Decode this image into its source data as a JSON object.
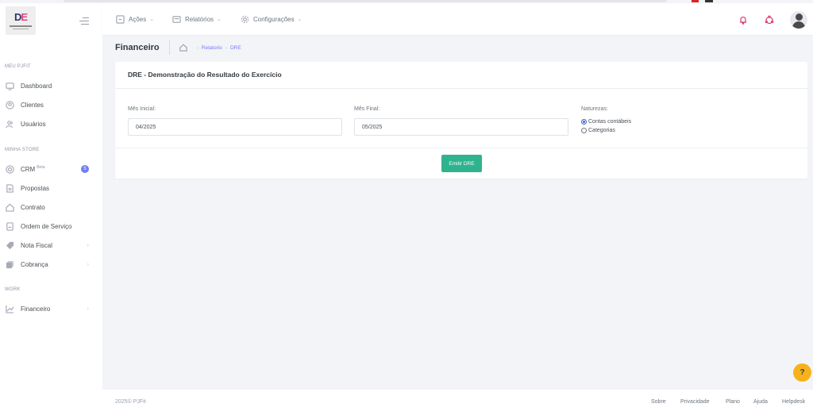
{
  "app": {
    "logo_text_a": "D",
    "logo_text_b": "E",
    "brand_colors": {
      "primary": "#35306e",
      "accent": "#e0457b",
      "success": "#2fb38e",
      "info": "#727cf5",
      "warning": "#f7b21b"
    }
  },
  "sidebar": {
    "sections": [
      {
        "label": "MEU PJFIT"
      },
      {
        "label": "MINHA STORE"
      },
      {
        "label": "WORK"
      }
    ],
    "items": [
      {
        "label": "Dashboard",
        "icon": "monitor-icon"
      },
      {
        "label": "Clientes",
        "icon": "user-circle-icon"
      },
      {
        "label": "Usuários",
        "icon": "users-icon"
      },
      {
        "label": "CRM",
        "beta": "Beta",
        "badge": "5",
        "icon": "target-icon"
      },
      {
        "label": "Propostas",
        "icon": "document-icon"
      },
      {
        "label": "Contrato",
        "icon": "home-icon"
      },
      {
        "label": "Ordem de Serviço",
        "icon": "file-icon"
      },
      {
        "label": "Nota Fiscal",
        "icon": "tag-icon",
        "chevron": "›"
      },
      {
        "label": "Cobrança",
        "icon": "copy-icon",
        "chevron": "›"
      },
      {
        "label": "Financeiro",
        "icon": "chart-line-icon",
        "chevron": "›"
      }
    ]
  },
  "topbar": {
    "menus": [
      {
        "label": "Ações",
        "icon": "box-icon"
      },
      {
        "label": "Relatórios",
        "icon": "report-icon"
      },
      {
        "label": "Configurações",
        "icon": "gear-icon"
      }
    ],
    "chevron": "⌄"
  },
  "header": {
    "title": "Financeiro",
    "breadcrumb": [
      "Relatorio",
      "DRE"
    ],
    "sep": "-"
  },
  "card": {
    "title": "DRE - Demonstração do Resultado do Exercício",
    "start_label": "Mês Inicial:",
    "start_value": "04/2025",
    "end_label": "Mês Final:",
    "end_value": "05/2025",
    "nature_label": "Naturezas:",
    "options": [
      {
        "label": "Contas contábeis",
        "checked": true
      },
      {
        "label": "Categorias",
        "checked": false
      }
    ],
    "button_label": "Emitir DRE"
  },
  "help": {
    "label": "?"
  },
  "footer": {
    "copyright_year": "2025©",
    "copyright_brand": "PJFit",
    "links": [
      "Sobre",
      "Privacidade",
      "Plano",
      "Ajuda",
      "Helpdesk"
    ]
  }
}
